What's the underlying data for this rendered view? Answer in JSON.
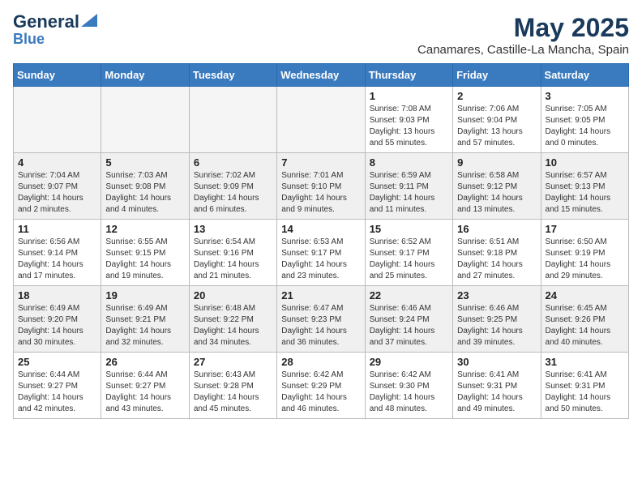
{
  "logo": {
    "general": "General",
    "blue": "Blue"
  },
  "header": {
    "title": "May 2025",
    "subtitle": "Canamares, Castille-La Mancha, Spain"
  },
  "weekdays": [
    "Sunday",
    "Monday",
    "Tuesday",
    "Wednesday",
    "Thursday",
    "Friday",
    "Saturday"
  ],
  "weeks": [
    [
      {
        "day": "",
        "info": ""
      },
      {
        "day": "",
        "info": ""
      },
      {
        "day": "",
        "info": ""
      },
      {
        "day": "",
        "info": ""
      },
      {
        "day": "1",
        "info": "Sunrise: 7:08 AM\nSunset: 9:03 PM\nDaylight: 13 hours\nand 55 minutes."
      },
      {
        "day": "2",
        "info": "Sunrise: 7:06 AM\nSunset: 9:04 PM\nDaylight: 13 hours\nand 57 minutes."
      },
      {
        "day": "3",
        "info": "Sunrise: 7:05 AM\nSunset: 9:05 PM\nDaylight: 14 hours\nand 0 minutes."
      }
    ],
    [
      {
        "day": "4",
        "info": "Sunrise: 7:04 AM\nSunset: 9:07 PM\nDaylight: 14 hours\nand 2 minutes."
      },
      {
        "day": "5",
        "info": "Sunrise: 7:03 AM\nSunset: 9:08 PM\nDaylight: 14 hours\nand 4 minutes."
      },
      {
        "day": "6",
        "info": "Sunrise: 7:02 AM\nSunset: 9:09 PM\nDaylight: 14 hours\nand 6 minutes."
      },
      {
        "day": "7",
        "info": "Sunrise: 7:01 AM\nSunset: 9:10 PM\nDaylight: 14 hours\nand 9 minutes."
      },
      {
        "day": "8",
        "info": "Sunrise: 6:59 AM\nSunset: 9:11 PM\nDaylight: 14 hours\nand 11 minutes."
      },
      {
        "day": "9",
        "info": "Sunrise: 6:58 AM\nSunset: 9:12 PM\nDaylight: 14 hours\nand 13 minutes."
      },
      {
        "day": "10",
        "info": "Sunrise: 6:57 AM\nSunset: 9:13 PM\nDaylight: 14 hours\nand 15 minutes."
      }
    ],
    [
      {
        "day": "11",
        "info": "Sunrise: 6:56 AM\nSunset: 9:14 PM\nDaylight: 14 hours\nand 17 minutes."
      },
      {
        "day": "12",
        "info": "Sunrise: 6:55 AM\nSunset: 9:15 PM\nDaylight: 14 hours\nand 19 minutes."
      },
      {
        "day": "13",
        "info": "Sunrise: 6:54 AM\nSunset: 9:16 PM\nDaylight: 14 hours\nand 21 minutes."
      },
      {
        "day": "14",
        "info": "Sunrise: 6:53 AM\nSunset: 9:17 PM\nDaylight: 14 hours\nand 23 minutes."
      },
      {
        "day": "15",
        "info": "Sunrise: 6:52 AM\nSunset: 9:17 PM\nDaylight: 14 hours\nand 25 minutes."
      },
      {
        "day": "16",
        "info": "Sunrise: 6:51 AM\nSunset: 9:18 PM\nDaylight: 14 hours\nand 27 minutes."
      },
      {
        "day": "17",
        "info": "Sunrise: 6:50 AM\nSunset: 9:19 PM\nDaylight: 14 hours\nand 29 minutes."
      }
    ],
    [
      {
        "day": "18",
        "info": "Sunrise: 6:49 AM\nSunset: 9:20 PM\nDaylight: 14 hours\nand 30 minutes."
      },
      {
        "day": "19",
        "info": "Sunrise: 6:49 AM\nSunset: 9:21 PM\nDaylight: 14 hours\nand 32 minutes."
      },
      {
        "day": "20",
        "info": "Sunrise: 6:48 AM\nSunset: 9:22 PM\nDaylight: 14 hours\nand 34 minutes."
      },
      {
        "day": "21",
        "info": "Sunrise: 6:47 AM\nSunset: 9:23 PM\nDaylight: 14 hours\nand 36 minutes."
      },
      {
        "day": "22",
        "info": "Sunrise: 6:46 AM\nSunset: 9:24 PM\nDaylight: 14 hours\nand 37 minutes."
      },
      {
        "day": "23",
        "info": "Sunrise: 6:46 AM\nSunset: 9:25 PM\nDaylight: 14 hours\nand 39 minutes."
      },
      {
        "day": "24",
        "info": "Sunrise: 6:45 AM\nSunset: 9:26 PM\nDaylight: 14 hours\nand 40 minutes."
      }
    ],
    [
      {
        "day": "25",
        "info": "Sunrise: 6:44 AM\nSunset: 9:27 PM\nDaylight: 14 hours\nand 42 minutes."
      },
      {
        "day": "26",
        "info": "Sunrise: 6:44 AM\nSunset: 9:27 PM\nDaylight: 14 hours\nand 43 minutes."
      },
      {
        "day": "27",
        "info": "Sunrise: 6:43 AM\nSunset: 9:28 PM\nDaylight: 14 hours\nand 45 minutes."
      },
      {
        "day": "28",
        "info": "Sunrise: 6:42 AM\nSunset: 9:29 PM\nDaylight: 14 hours\nand 46 minutes."
      },
      {
        "day": "29",
        "info": "Sunrise: 6:42 AM\nSunset: 9:30 PM\nDaylight: 14 hours\nand 48 minutes."
      },
      {
        "day": "30",
        "info": "Sunrise: 6:41 AM\nSunset: 9:31 PM\nDaylight: 14 hours\nand 49 minutes."
      },
      {
        "day": "31",
        "info": "Sunrise: 6:41 AM\nSunset: 9:31 PM\nDaylight: 14 hours\nand 50 minutes."
      }
    ]
  ]
}
